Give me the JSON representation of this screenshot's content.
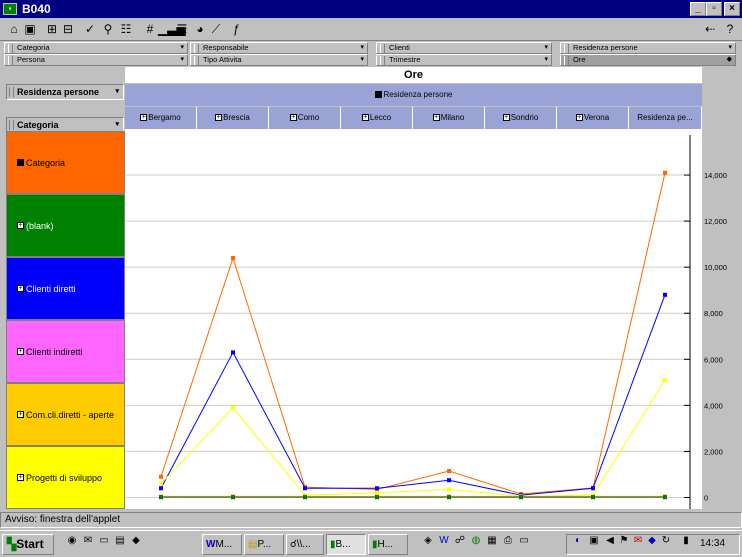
{
  "window": {
    "title": "B040"
  },
  "dimensions": {
    "row1": [
      "Categoria",
      "Responsabile",
      "Clienti",
      "Residenza persone"
    ],
    "row2": [
      "Persona",
      "Tipo Attivita",
      "Trimestre",
      "Ore"
    ]
  },
  "left_panel": {
    "row_selector": "Residenza persone",
    "col_selector": "Categoria",
    "categories": [
      {
        "label": "Categoria",
        "color": "#ff6600",
        "marker": "minus"
      },
      {
        "label": "(blank)",
        "color": "#008000",
        "marker": "plus"
      },
      {
        "label": "Clienti diretti",
        "color": "#0000ff",
        "marker": "plus"
      },
      {
        "label": "Clienti indiretti",
        "color": "#ff66ff",
        "marker": "plus"
      },
      {
        "label": "Com.cli.diretti - aperte",
        "color": "#ffcc00",
        "marker": "plus"
      },
      {
        "label": "Progetti di sviluppo",
        "color": "#ffff00",
        "marker": "plus"
      }
    ]
  },
  "header": {
    "measure": "Ore",
    "dimension": "Residenza persone",
    "cities": [
      "Bergamo",
      "Brescia",
      "Como",
      "Lecco",
      "Milano",
      "Sondrio",
      "Verona",
      "Residenza pe..."
    ]
  },
  "chart_data": {
    "type": "line",
    "categories": [
      "Bergamo",
      "Brescia",
      "Como",
      "Lecco",
      "Milano",
      "Sondrio",
      "Verona",
      "Residenza pe..."
    ],
    "yticks": [
      "0",
      "2,000",
      "4,000",
      "6,000",
      "8,000",
      "10,000",
      "12,000",
      "14,000"
    ],
    "ylim": [
      -500,
      16000
    ],
    "series": [
      {
        "color": "#ff6600",
        "values": [
          900,
          10400,
          450,
          350,
          1150,
          150,
          420,
          14100
        ]
      },
      {
        "color": "#0000ff",
        "values": [
          400,
          6300,
          400,
          400,
          750,
          100,
          400,
          8800
        ]
      },
      {
        "color": "#ffff00",
        "values": [
          600,
          3900,
          100,
          200,
          350,
          50,
          100,
          5100
        ]
      },
      {
        "color": "#ffcc00",
        "values": [
          50,
          50,
          50,
          50,
          50,
          50,
          50,
          50
        ]
      },
      {
        "color": "#ff66ff",
        "values": [
          0,
          0,
          0,
          0,
          0,
          0,
          0,
          0
        ]
      },
      {
        "color": "#008000",
        "values": [
          20,
          20,
          20,
          20,
          20,
          20,
          20,
          20
        ]
      }
    ]
  },
  "status": {
    "text": "Avviso: finestra dell'applet"
  },
  "taskbar": {
    "start": "Start",
    "tasks": [
      "M...",
      "P...",
      "\\\\...",
      "B...",
      "H..."
    ],
    "clock": "14:34"
  }
}
